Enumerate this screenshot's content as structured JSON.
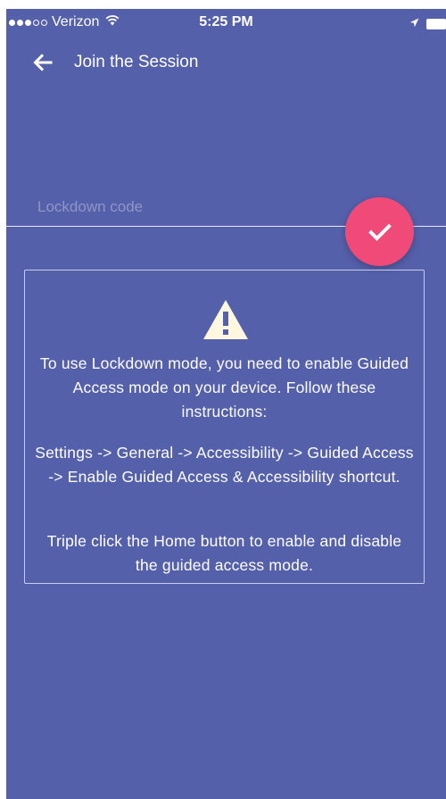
{
  "status_bar": {
    "carrier": "Verizon",
    "time": "5:25 PM",
    "signal_icon": "signal-dots-icon",
    "wifi_icon": "wifi-icon",
    "location_icon": "location-arrow-icon",
    "battery_icon": "battery-icon"
  },
  "app_bar": {
    "title": "Join the Session",
    "back_icon": "arrow-left-icon"
  },
  "lockdown": {
    "placeholder": "Lockdown code",
    "value": "",
    "submit_icon": "checkmark-icon"
  },
  "info": {
    "icon": "warning-triangle-icon",
    "paragraph1": "To use Lockdown mode, you need to enable Guided Access mode on your device. Follow these instructions:",
    "paragraph2": "Settings -> General -> Accessibility -> Guided Access -> Enable Guided Access & Accessibility shortcut.",
    "paragraph3": "Triple click the Home button to enable and disable the guided access mode."
  },
  "colors": {
    "background": "#5560ab",
    "accent": "#f04a78",
    "warning_icon": "#fdf7e0"
  }
}
